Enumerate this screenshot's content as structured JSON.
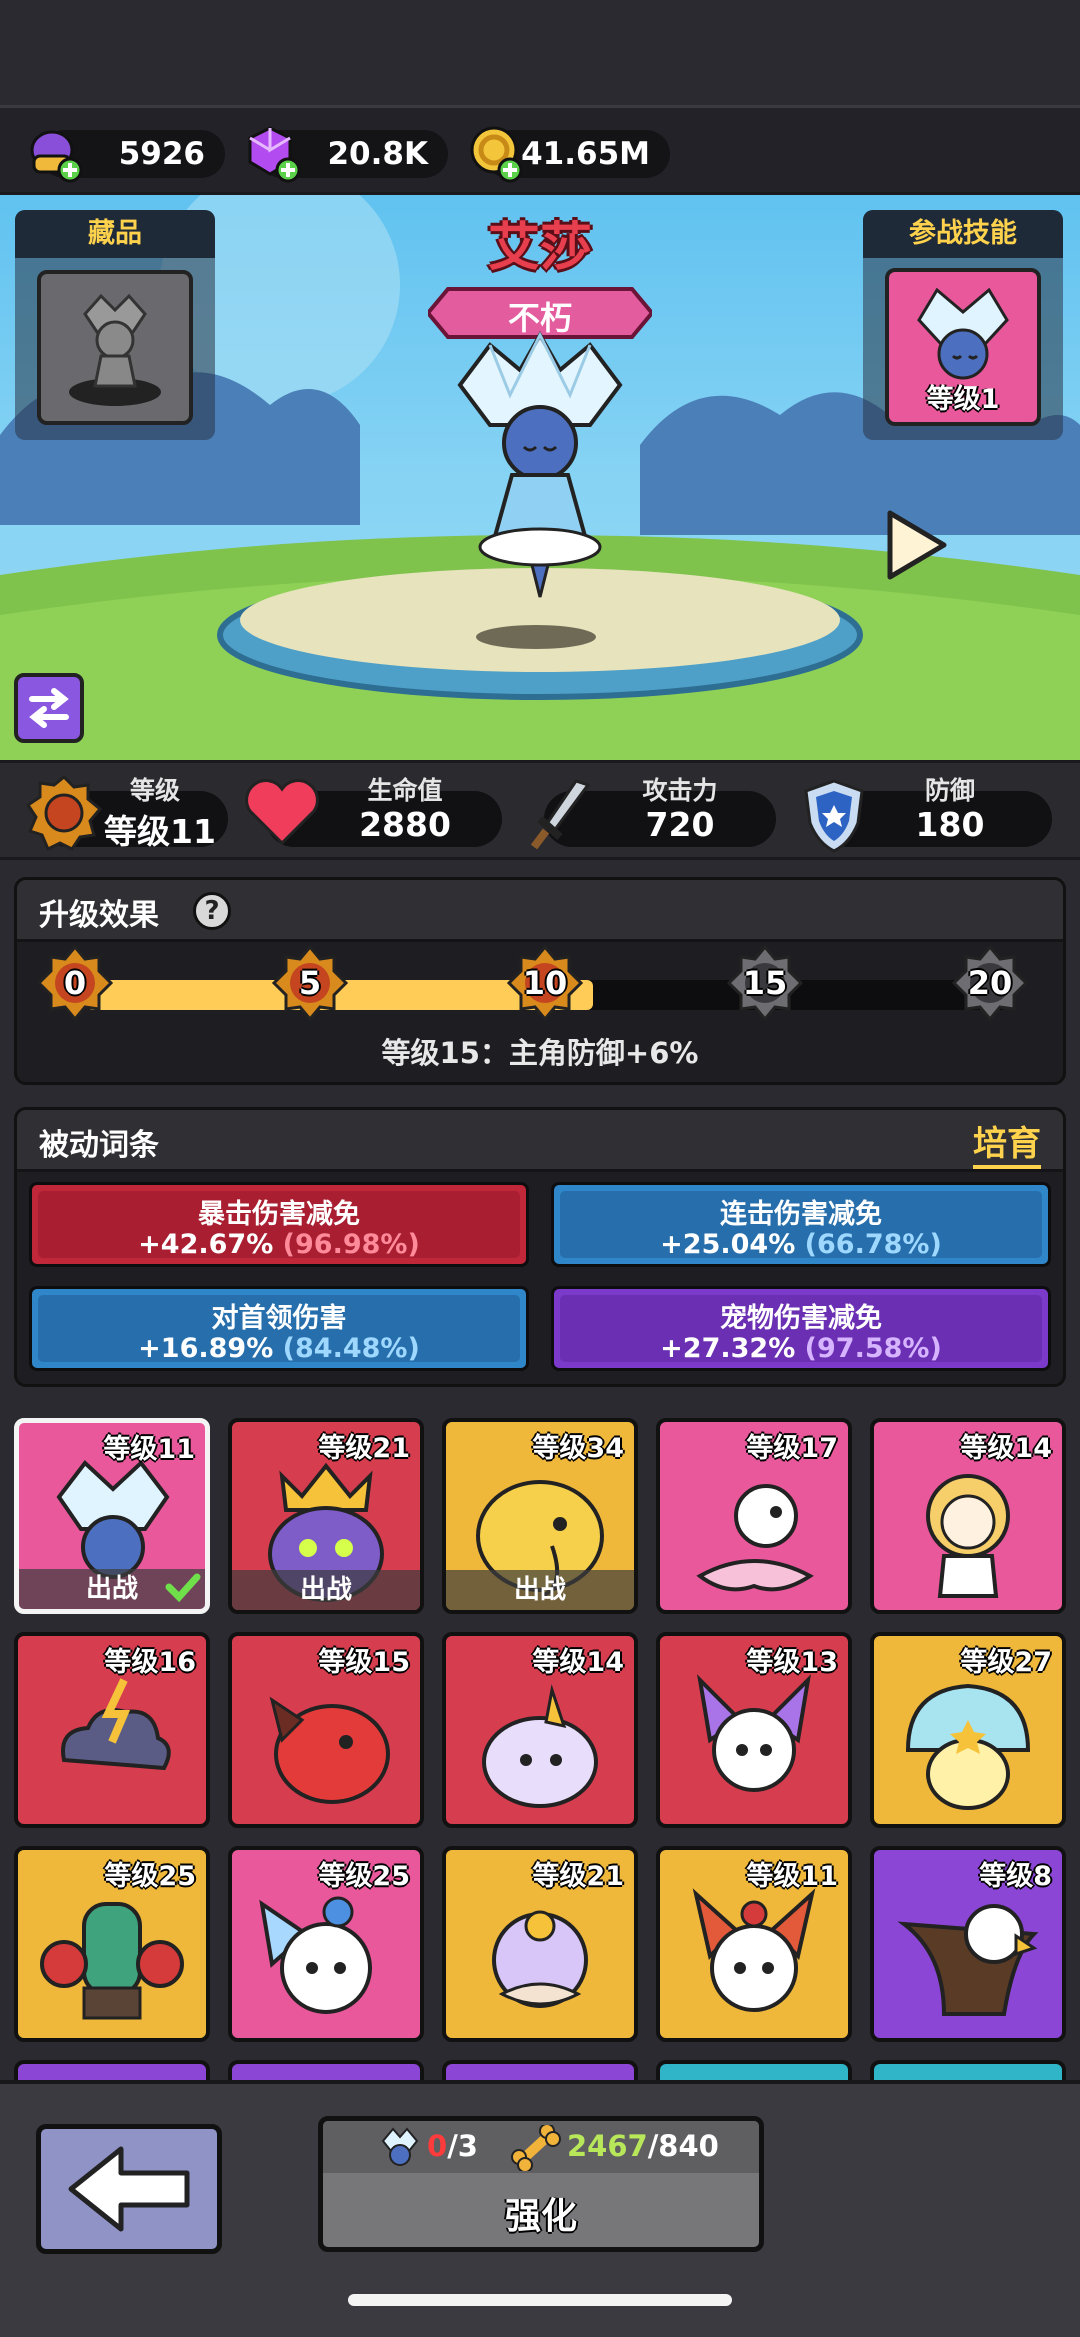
{
  "currencies": [
    {
      "icon": "purple-egg-icon",
      "value": "5926"
    },
    {
      "icon": "purple-gem-icon",
      "value": "20.8K"
    },
    {
      "icon": "gold-coin-icon",
      "value": "41.65M"
    }
  ],
  "hero": {
    "name": "艾莎",
    "rank": "不朽",
    "collection_label": "藏品",
    "battle_skill_label": "参战技能",
    "skill_level": "等级1"
  },
  "stats": {
    "level": {
      "label": "等级",
      "value": "等级11"
    },
    "hp": {
      "label": "生命值",
      "value": "2880"
    },
    "attack": {
      "label": "攻击力",
      "value": "720"
    },
    "defense": {
      "label": "防御",
      "value": "180"
    }
  },
  "upgrade": {
    "title": "升级效果",
    "milestones": [
      "0",
      "5",
      "10",
      "15",
      "20"
    ],
    "progress_fraction": 0.55,
    "desc": "等级15：主角防御+6%"
  },
  "passive": {
    "title": "被动词条",
    "cultivate": "培育",
    "affixes": [
      {
        "name": "暴击伤害减免",
        "value": "+42.67%",
        "max": "(96.98%)",
        "color": "#c0283a",
        "max_color": "#ff8a9a"
      },
      {
        "name": "连击伤害减免",
        "value": "+25.04%",
        "max": "(66.78%)",
        "color": "#2f86c8",
        "max_color": "#9fd8ff"
      },
      {
        "name": "对首领伤害",
        "value": "+16.89%",
        "max": "(84.48%)",
        "color": "#2f86c8",
        "max_color": "#9fd8ff"
      },
      {
        "name": "宠物伤害减免",
        "value": "+27.32%",
        "max": "(97.58%)",
        "color": "#7b3ac9",
        "max_color": "#d7b4ff"
      }
    ]
  },
  "pets": [
    {
      "level": "等级11",
      "deployed": "出战",
      "bg": "#e8589a",
      "icon": "ice-crystal-girl-icon",
      "selected": true
    },
    {
      "level": "等级21",
      "deployed": "出战",
      "bg": "#d63d4e",
      "icon": "crowned-purple-blob-icon"
    },
    {
      "level": "等级34",
      "deployed": "出战",
      "bg": "#f0b83a",
      "icon": "yellow-elephant-icon"
    },
    {
      "level": "等级17",
      "bg": "#e8589a",
      "icon": "white-dragon-icon"
    },
    {
      "level": "等级14",
      "bg": "#e8589a",
      "icon": "cat-girl-icon"
    },
    {
      "level": "等级16",
      "bg": "#d63d4e",
      "icon": "storm-cloud-icon"
    },
    {
      "level": "等级15",
      "bg": "#d63d4e",
      "icon": "red-dragon-icon"
    },
    {
      "level": "等级14",
      "bg": "#d63d4e",
      "icon": "unicorn-slime-icon"
    },
    {
      "level": "等级13",
      "bg": "#d63d4e",
      "icon": "purple-fox-icon"
    },
    {
      "level": "等级27",
      "bg": "#f0b83a",
      "icon": "mushroom-icon"
    },
    {
      "level": "等级25",
      "bg": "#f0b83a",
      "icon": "cactus-boxer-icon"
    },
    {
      "level": "等级25",
      "bg": "#e8589a",
      "icon": "blue-fox-icon"
    },
    {
      "level": "等级21",
      "bg": "#f0b83a",
      "icon": "genie-turban-icon"
    },
    {
      "level": "等级11",
      "bg": "#f0b83a",
      "icon": "red-fox-icon"
    },
    {
      "level": "等级8",
      "bg": "#8b46d6",
      "icon": "eagle-icon"
    }
  ],
  "bottom": {
    "shard_have": "0",
    "shard_need": "/3",
    "bone_have": "2467",
    "bone_need": "/840",
    "enhance_label": "强化"
  }
}
